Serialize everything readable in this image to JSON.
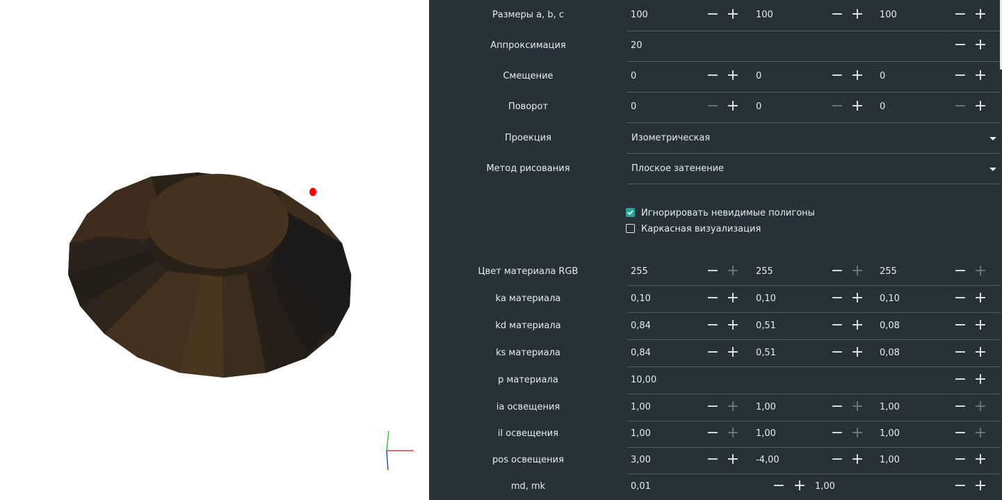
{
  "viewport": {
    "light_color": "#ff0000",
    "axis_colors": {
      "x": "#e53935",
      "y": "#2ecc40",
      "z": "#2f4fd8"
    },
    "shade_colors": [
      "#4a3520",
      "#3e2d1c",
      "#2e241a",
      "#221d17",
      "#1d1b19"
    ]
  },
  "panel": {
    "background": "#263238",
    "accent": "#26a69a",
    "rows": {
      "sizes": {
        "label": "Размеры a, b, c",
        "v1": "100",
        "v2": "100",
        "v3": "100"
      },
      "approx": {
        "label": "Аппроксимация",
        "v1": "20"
      },
      "offset": {
        "label": "Смещение",
        "v1": "0",
        "v2": "0",
        "v3": "0"
      },
      "rotation": {
        "label": "Поворот",
        "v1": "0",
        "v2": "0",
        "v3": "0"
      },
      "projection": {
        "label": "Проекция",
        "value": "Изометрическая"
      },
      "draw_method": {
        "label": "Метод рисования",
        "value": "Плоское затенение"
      },
      "color": {
        "label": "Цвет материала RGB",
        "v1": "255",
        "v2": "255",
        "v3": "255"
      },
      "ka": {
        "label": "ka материала",
        "v1": "0,10",
        "v2": "0,10",
        "v3": "0,10"
      },
      "kd": {
        "label": "kd материала",
        "v1": "0,84",
        "v2": "0,51",
        "v3": "0,08"
      },
      "ks": {
        "label": "ks материала",
        "v1": "0,84",
        "v2": "0,51",
        "v3": "0,08"
      },
      "p": {
        "label": "p материала",
        "v1": "10,00"
      },
      "ia": {
        "label": "ia освещения",
        "v1": "1,00",
        "v2": "1,00",
        "v3": "1,00"
      },
      "il": {
        "label": "il освещения",
        "v1": "1,00",
        "v2": "1,00",
        "v3": "1,00"
      },
      "pos": {
        "label": "pos освещения",
        "v1": "3,00",
        "v2": "-4,00",
        "v3": "1,00"
      },
      "md": {
        "label": "md, mk",
        "v1": "0,01",
        "v2": "1,00"
      }
    },
    "checkboxes": {
      "ignore_invisible": {
        "label": "Игнорировать невидимые полигоны",
        "checked": true
      },
      "wireframe": {
        "label": "Каркасная визуализация",
        "checked": false
      }
    },
    "buttons": {
      "minus": "−",
      "plus": "+"
    }
  }
}
